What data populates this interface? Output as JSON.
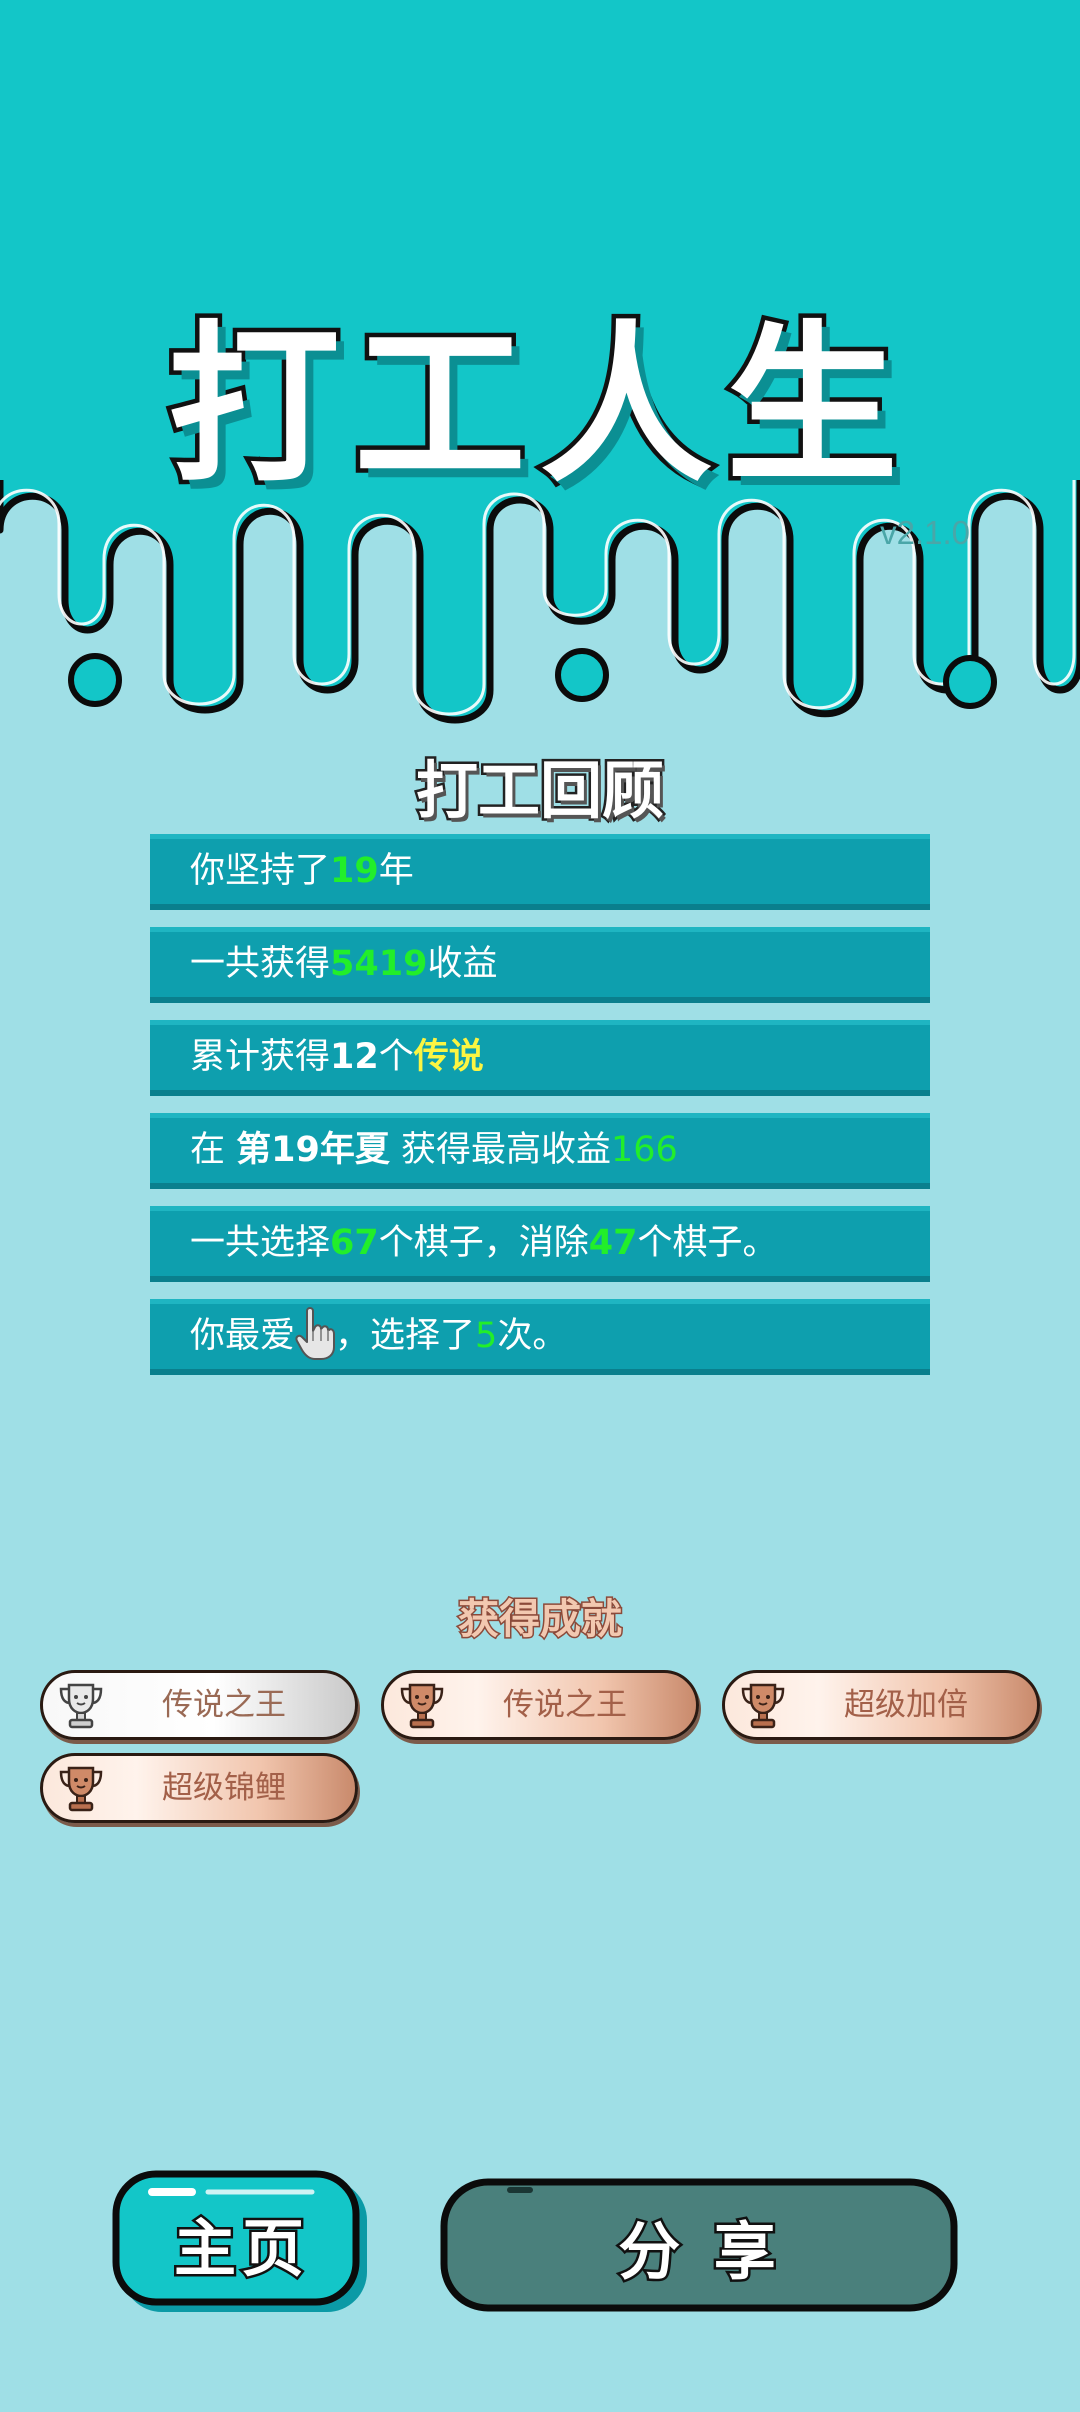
{
  "header": {
    "title": "打工人生",
    "version": "v2.1.0"
  },
  "review": {
    "title": "打工回顾",
    "years": {
      "prefix": "你坚持了",
      "value": "19",
      "suffix": "年"
    },
    "income": {
      "prefix": "一共获得",
      "value": "5419",
      "suffix": "收益"
    },
    "legend": {
      "prefix": "累计获得",
      "value": "12",
      "middle": "个",
      "highlight": "传说"
    },
    "best": {
      "prefix": "在 ",
      "period": "第19年夏",
      "middle": " 获得最高收益",
      "value": "166"
    },
    "pieces": {
      "prefix": "一共选择",
      "selected": "67",
      "middle": "个棋子，消除",
      "removed": "47",
      "suffix": "个棋子。"
    },
    "favorite": {
      "prefix": "你最爱",
      "icon": "pointing-hand-icon",
      "middle": "，选择了",
      "value": "5",
      "suffix": "次。"
    }
  },
  "achievements": {
    "title": "获得成就",
    "items": [
      {
        "label": "传说之王",
        "tier": "silver"
      },
      {
        "label": "传说之王",
        "tier": "bronze"
      },
      {
        "label": "超级加倍",
        "tier": "bronze"
      },
      {
        "label": "超级锦鲤",
        "tier": "bronze"
      }
    ]
  },
  "buttons": {
    "home": "主页",
    "share": "分 享"
  },
  "colors": {
    "header_teal": "#13c6c8",
    "background": "#9fdfe6",
    "row_teal": "#0e9fae",
    "highlight_green": "#22ee2a",
    "highlight_yellow": "#fbf542",
    "share_button": "#4a807c"
  }
}
